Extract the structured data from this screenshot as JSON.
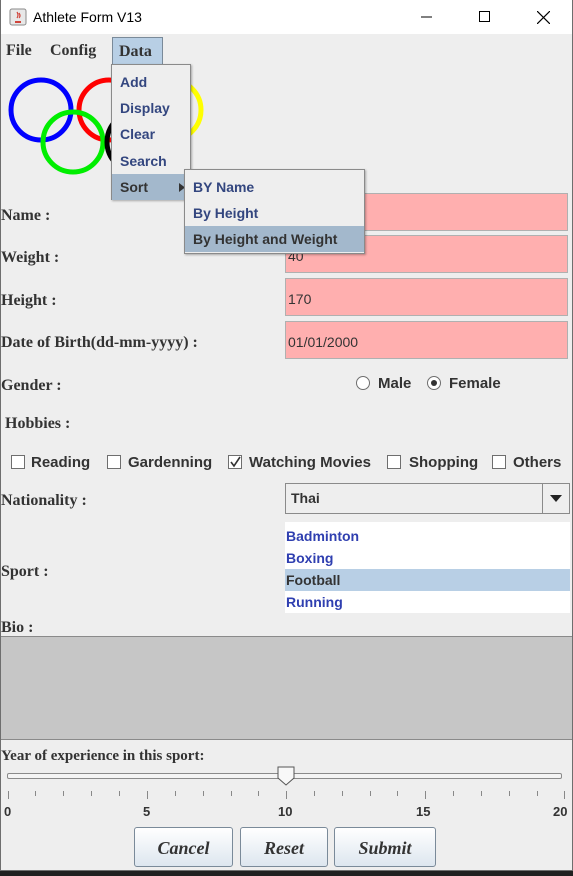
{
  "window": {
    "title": "Athlete Form V13"
  },
  "menubar": {
    "file": "File",
    "config": "Config",
    "data": "Data"
  },
  "data_menu": {
    "items": [
      "Add",
      "Display",
      "Clear",
      "Search",
      "Sort"
    ]
  },
  "sort_menu": {
    "items": [
      "BY Name",
      "By Height",
      "By Height and Weight"
    ],
    "selected": "By Height and Weight"
  },
  "form": {
    "name_label": "Name :",
    "name_value": "",
    "weight_label": "Weight :",
    "weight_value": "40",
    "height_label": "Height :",
    "height_value": "170",
    "dob_label": "Date of Birth(dd-mm-yyyy) :",
    "dob_value": "01/01/2000",
    "gender_label": "Gender :",
    "gender_options": [
      "Male",
      "Female"
    ],
    "gender_selected": "Female",
    "hobbies_label": "Hobbies :",
    "hobbies": [
      {
        "label": "Reading",
        "checked": false
      },
      {
        "label": "Gardenning",
        "checked": false
      },
      {
        "label": "Watching Movies",
        "checked": true
      },
      {
        "label": "Shopping",
        "checked": false
      },
      {
        "label": "Others",
        "checked": false
      }
    ],
    "nationality_label": "Nationality :",
    "nationality_value": "Thai",
    "sport_label": "Sport :",
    "sports": [
      "Badminton",
      "Boxing",
      "Football",
      "Running"
    ],
    "sport_selected": "Football",
    "bio_label": "Bio :",
    "experience_label": "Year of experience in this sport:",
    "experience_value": 10,
    "slider_min": 0,
    "slider_max": 20,
    "slider_ticks": [
      "0",
      "5",
      "10",
      "15",
      "20"
    ]
  },
  "buttons": {
    "cancel": "Cancel",
    "reset": "Reset",
    "submit": "Submit"
  },
  "colors": {
    "field_bg": "#ffafaf",
    "menu_selected": "#b8cfe5",
    "list_text": "#2f3fb0"
  }
}
